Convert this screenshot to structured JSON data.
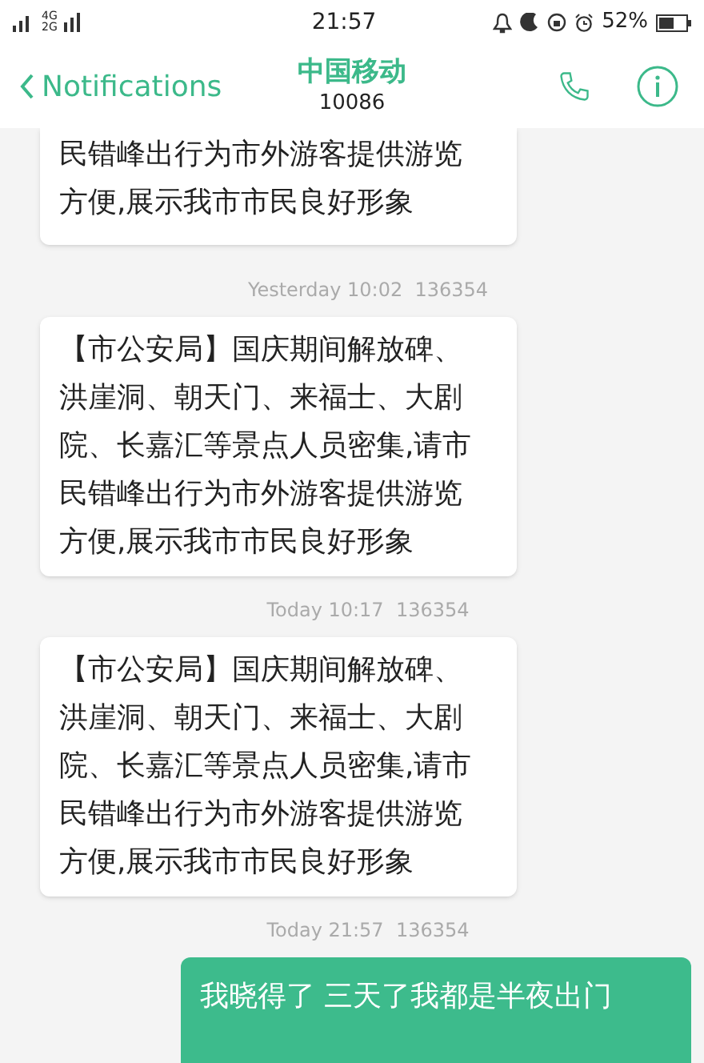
{
  "status_bar": {
    "network_top": "4G",
    "network_bottom": "2G",
    "time": "21:57",
    "battery": "52%"
  },
  "header": {
    "back_label": "Notifications",
    "title": "中国移动",
    "number": "10086"
  },
  "messages": [
    {
      "kind": "incoming",
      "text": "民错峰出行为市外游客提供游览方便,展示我市市民良好形象"
    },
    {
      "kind": "timestamp",
      "text": "Yesterday 10:02  136354"
    },
    {
      "kind": "incoming",
      "text": "【市公安局】国庆期间解放碑、洪崖洞、朝天门、来福士、大剧院、长嘉汇等景点人员密集,请市民错峰出行为市外游客提供游览方便,展示我市市民良好形象"
    },
    {
      "kind": "timestamp",
      "text": "Today 10:17  136354"
    },
    {
      "kind": "incoming",
      "text": "【市公安局】国庆期间解放碑、洪崖洞、朝天门、来福士、大剧院、长嘉汇等景点人员密集,请市民错峰出行为市外游客提供游览方便,展示我市市民良好形象"
    },
    {
      "kind": "timestamp",
      "text": "Today 21:57  136354"
    },
    {
      "kind": "outgoing",
      "text": "我晓得了 三天了我都是半夜出门"
    }
  ]
}
